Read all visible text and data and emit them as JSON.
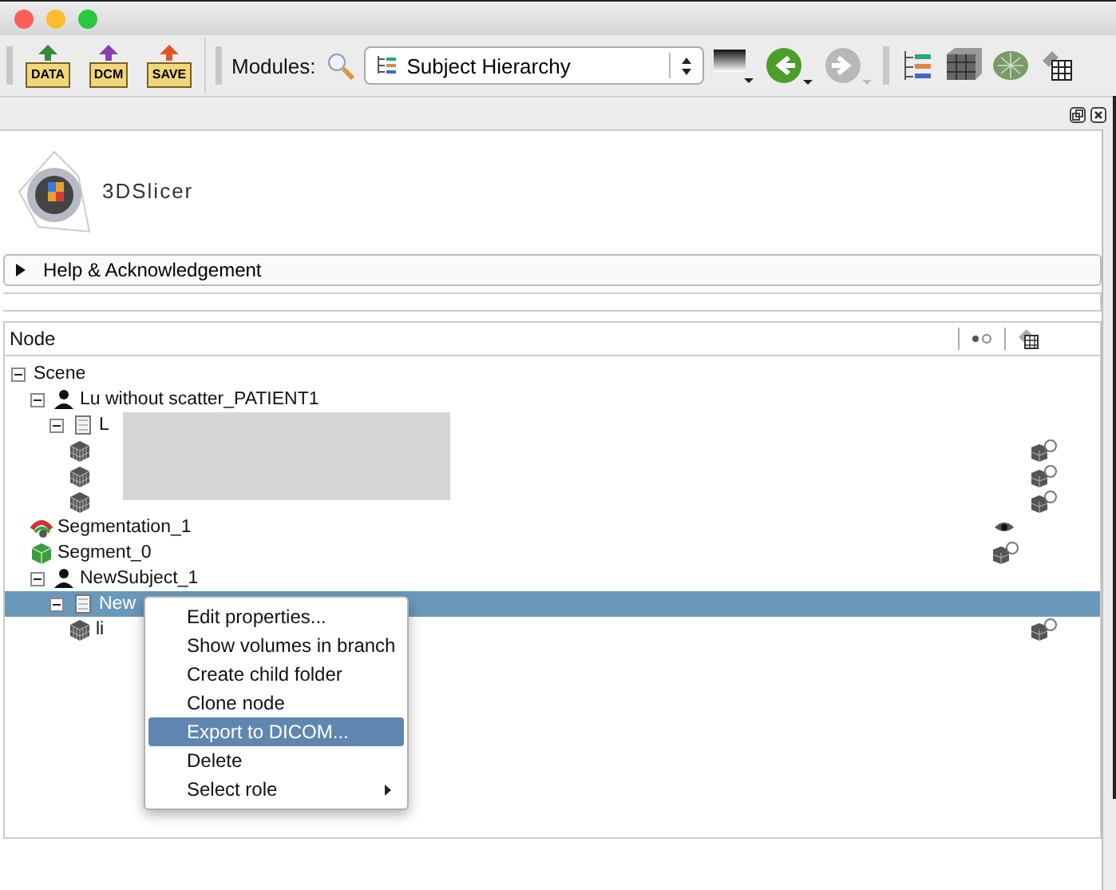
{
  "toolbar": {
    "file_buttons": [
      {
        "label": "DATA",
        "color": "#2e8b3a"
      },
      {
        "label": "DCM",
        "color": "#8a3fb0"
      },
      {
        "label": "SAVE",
        "color": "#e0562a"
      }
    ],
    "modules_label": "Modules:",
    "module_select": "Subject Hierarchy",
    "back_enabled": true,
    "forward_enabled": false
  },
  "logo": {
    "text": "3DSlicer"
  },
  "help_section": {
    "title": "Help & Acknowledgement",
    "expanded": false
  },
  "tree": {
    "columns": [
      "Node"
    ],
    "items": [
      {
        "name": "Scene",
        "expanded": true,
        "selected": false,
        "children": [
          {
            "name": "Lu without scatter_PATIENT1",
            "kind": "patient",
            "expanded": true,
            "selected": false,
            "children": [
              {
                "name": "L",
                "kind": "study",
                "expanded": true,
                "selected": false,
                "children": [
                  {
                    "kind": "volume",
                    "selected": false
                  },
                  {
                    "kind": "volume",
                    "selected": false
                  },
                  {
                    "kind": "volume",
                    "selected": false
                  }
                ]
              }
            ]
          },
          {
            "name": "Segmentation_1",
            "kind": "segmentation",
            "selected": false
          },
          {
            "name": "Segment_0",
            "kind": "segment",
            "selected": false
          },
          {
            "name": "NewSubject_1",
            "kind": "patient",
            "expanded": true,
            "selected": false,
            "children": [
              {
                "name": "New",
                "kind": "study",
                "expanded": true,
                "selected": true,
                "children": [
                  {
                    "name": "li",
                    "kind": "volume",
                    "selected": false
                  }
                ]
              }
            ]
          }
        ]
      }
    ]
  },
  "context_menu": [
    {
      "label": "Edit properties...",
      "selected": false
    },
    {
      "label": "Show volumes in branch",
      "selected": false
    },
    {
      "label": "Create child folder",
      "selected": false
    },
    {
      "label": "Clone node",
      "selected": false
    },
    {
      "label": "Export to DICOM...",
      "selected": true
    },
    {
      "label": "Delete",
      "selected": false
    },
    {
      "label": "Select role",
      "selected": false,
      "submenu": true
    }
  ]
}
